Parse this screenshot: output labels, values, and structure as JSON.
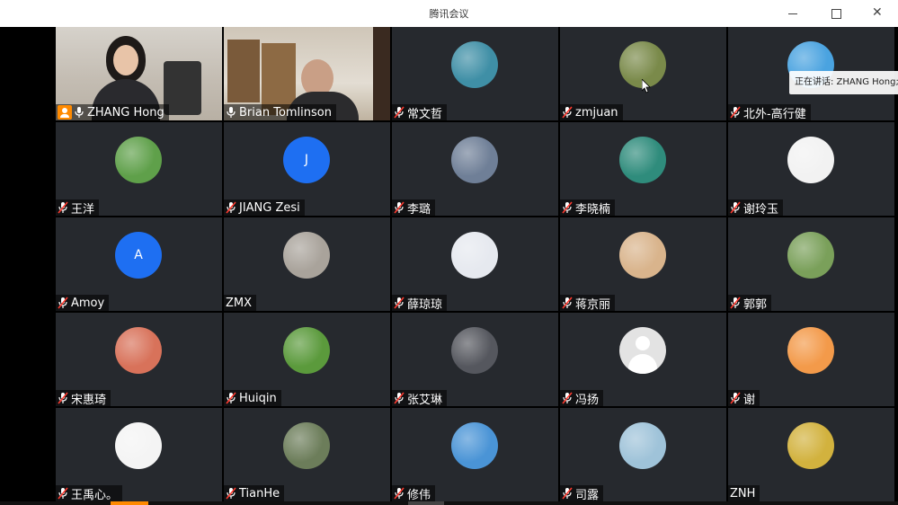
{
  "window": {
    "title": "腾讯会议"
  },
  "speaking_indicator": "正在讲话: ZHANG Hong;",
  "participants": [
    {
      "name": "ZHANG Hong",
      "mic": "on",
      "host": true,
      "avatar_type": "video",
      "avatar_color": "#c9c1b5"
    },
    {
      "name": "Brian Tomlinson",
      "mic": "on",
      "host": false,
      "avatar_type": "video",
      "avatar_color": "#9c7f5a"
    },
    {
      "name": "常文哲",
      "mic": "muted",
      "host": false,
      "avatar_type": "photo",
      "avatar_color": "#3f8fa6"
    },
    {
      "name": "zmjuan",
      "mic": "muted",
      "host": false,
      "avatar_type": "photo",
      "avatar_color": "#7a8a4a"
    },
    {
      "name": "北外-高行健",
      "mic": "muted",
      "host": false,
      "avatar_type": "photo",
      "avatar_color": "#4aa3e0"
    },
    {
      "name": "王洋",
      "mic": "muted",
      "host": false,
      "avatar_type": "photo",
      "avatar_color": "#5fa04a"
    },
    {
      "name": "JIANG Zesi",
      "mic": "muted",
      "host": false,
      "avatar_type": "letter",
      "avatar_letter": "J",
      "avatar_color": "#1e6ff2"
    },
    {
      "name": "李璐",
      "mic": "muted",
      "host": false,
      "avatar_type": "photo",
      "avatar_color": "#6f7f97"
    },
    {
      "name": "李晓楠",
      "mic": "muted",
      "host": false,
      "avatar_type": "photo",
      "avatar_color": "#2f8c7c"
    },
    {
      "name": "谢玲玉",
      "mic": "muted",
      "host": false,
      "avatar_type": "photo",
      "avatar_color": "#f2f2f2"
    },
    {
      "name": "Amoy",
      "mic": "muted",
      "host": false,
      "avatar_type": "letter",
      "avatar_letter": "A",
      "avatar_color": "#1e6ff2"
    },
    {
      "name": "ZMX",
      "mic": "none",
      "host": false,
      "avatar_type": "photo",
      "avatar_color": "#a9a39b"
    },
    {
      "name": "薛琼琼",
      "mic": "muted",
      "host": false,
      "avatar_type": "photo",
      "avatar_color": "#e6e9ef"
    },
    {
      "name": "蒋京丽",
      "mic": "muted",
      "host": false,
      "avatar_type": "photo",
      "avatar_color": "#d9b48c"
    },
    {
      "name": "郭郭",
      "mic": "muted",
      "host": false,
      "avatar_type": "photo",
      "avatar_color": "#7aa05a"
    },
    {
      "name": "宋惠琦",
      "mic": "muted",
      "host": false,
      "avatar_type": "photo",
      "avatar_color": "#d8725a"
    },
    {
      "name": "Huiqin",
      "mic": "muted",
      "host": false,
      "avatar_type": "photo",
      "avatar_color": "#5b9a3c"
    },
    {
      "name": "张艾琳",
      "mic": "muted",
      "host": false,
      "avatar_type": "photo",
      "avatar_color": "#55575e"
    },
    {
      "name": "冯扬",
      "mic": "muted",
      "host": false,
      "avatar_type": "placeholder",
      "avatar_color": "#e3e3e3"
    },
    {
      "name": "谢",
      "mic": "muted",
      "host": false,
      "avatar_type": "photo",
      "avatar_color": "#f39a4a"
    },
    {
      "name": "王禹心。",
      "mic": "muted",
      "host": false,
      "avatar_type": "photo",
      "avatar_color": "#f4f4f4"
    },
    {
      "name": "TianHe",
      "mic": "muted",
      "host": false,
      "avatar_type": "photo",
      "avatar_color": "#6c7d5a"
    },
    {
      "name": "修伟",
      "mic": "muted",
      "host": false,
      "avatar_type": "photo",
      "avatar_color": "#4a94d6"
    },
    {
      "name": "司露",
      "mic": "muted",
      "host": false,
      "avatar_type": "photo",
      "avatar_color": "#9fc3d9"
    },
    {
      "name": "ZNH",
      "mic": "none",
      "host": false,
      "avatar_type": "photo",
      "avatar_color": "#d2b23e"
    }
  ]
}
